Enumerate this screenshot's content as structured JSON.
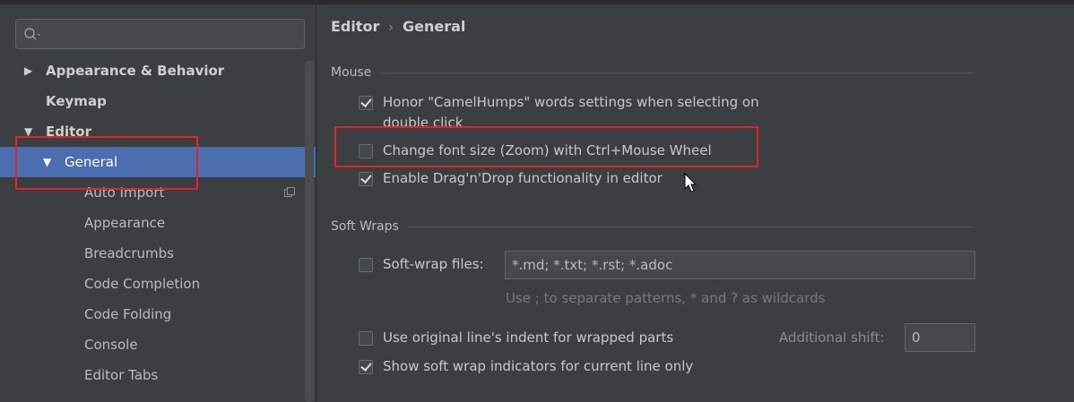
{
  "search": {
    "placeholder": ""
  },
  "sidebar": {
    "items": [
      {
        "label": "Appearance & Behavior",
        "bold": true,
        "arrow": "▶"
      },
      {
        "label": "Keymap",
        "bold": true,
        "arrow": ""
      },
      {
        "label": "Editor",
        "bold": true,
        "arrow": "▼"
      },
      {
        "label": "General",
        "bold": false,
        "arrow": "▼",
        "selected": true
      },
      {
        "label": "Auto Import",
        "bold": false,
        "arrow": ""
      },
      {
        "label": "Appearance",
        "bold": false,
        "arrow": ""
      },
      {
        "label": "Breadcrumbs",
        "bold": false,
        "arrow": ""
      },
      {
        "label": "Code Completion",
        "bold": false,
        "arrow": ""
      },
      {
        "label": "Code Folding",
        "bold": false,
        "arrow": ""
      },
      {
        "label": "Console",
        "bold": false,
        "arrow": ""
      },
      {
        "label": "Editor Tabs",
        "bold": false,
        "arrow": ""
      }
    ]
  },
  "breadcrumb": {
    "parent": "Editor",
    "separator": "›",
    "current": "General"
  },
  "mouse": {
    "title": "Mouse",
    "options": [
      {
        "label": "Honor \"CamelHumps\" words settings when selecting on",
        "label2": "double click",
        "checked": true
      },
      {
        "label": "Change font size (Zoom) with Ctrl+Mouse Wheel",
        "checked": false
      },
      {
        "label": "Enable Drag'n'Drop functionality in editor",
        "checked": true
      }
    ]
  },
  "soft_wraps": {
    "title": "Soft Wraps",
    "soft_wrap_files_label": "Soft-wrap files:",
    "soft_wrap_files_value": "*.md; *.txt; *.rst; *.adoc",
    "soft_wrap_files_checked": false,
    "hint": "Use ; to separate patterns, * and ? as wildcards",
    "original_indent_label": "Use original line's indent for wrapped parts",
    "original_indent_checked": false,
    "additional_shift_label": "Additional shift:",
    "additional_shift_value": "0",
    "show_indicators_label": "Show soft wrap indicators for current line only",
    "show_indicators_checked": true
  },
  "colors": {
    "background": "#3c3f41",
    "selection": "#4b6eaf",
    "highlight_box": "#e0242b"
  }
}
